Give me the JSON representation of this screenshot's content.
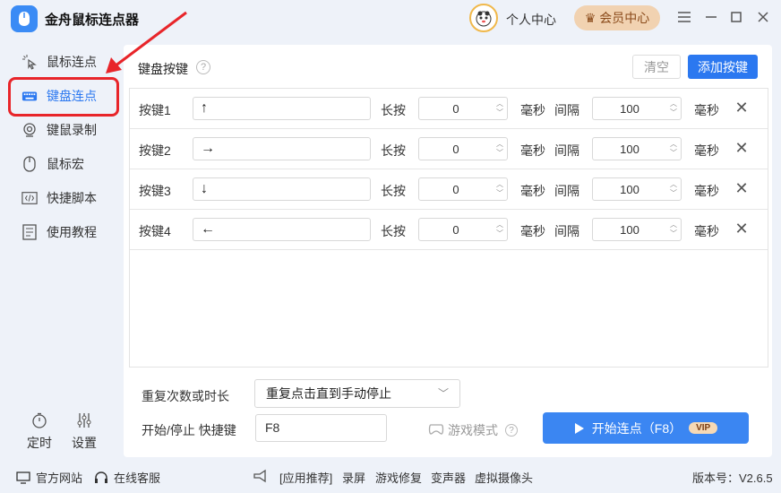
{
  "app": {
    "title": "金舟鼠标连点器"
  },
  "header": {
    "personal_center": "个人中心",
    "vip_center": "会员中心"
  },
  "sidebar": {
    "items": [
      {
        "label": "鼠标连点",
        "icon": "cursor-click-icon"
      },
      {
        "label": "键盘连点",
        "icon": "keyboard-icon"
      },
      {
        "label": "键鼠录制",
        "icon": "webcam-record-icon"
      },
      {
        "label": "鼠标宏",
        "icon": "mouse-icon"
      },
      {
        "label": "快捷脚本",
        "icon": "code-icon"
      },
      {
        "label": "使用教程",
        "icon": "document-icon"
      }
    ],
    "timer_label": "定时",
    "settings_label": "设置"
  },
  "main": {
    "title": "键盘按键",
    "help": "?",
    "clear_label": "清空",
    "add_label": "添加按键",
    "rows": [
      {
        "label": "按键1",
        "key": "↑",
        "press_label": "长按",
        "press_value": "0",
        "ms": "毫秒",
        "interval_label": "间隔",
        "interval_value": "100",
        "ms2": "毫秒"
      },
      {
        "label": "按键2",
        "key": "→",
        "press_label": "长按",
        "press_value": "0",
        "ms": "毫秒",
        "interval_label": "间隔",
        "interval_value": "100",
        "ms2": "毫秒"
      },
      {
        "label": "按键3",
        "key": "↓",
        "press_label": "长按",
        "press_value": "0",
        "ms": "毫秒",
        "interval_label": "间隔",
        "interval_value": "100",
        "ms2": "毫秒"
      },
      {
        "label": "按键4",
        "key": "←",
        "press_label": "长按",
        "press_value": "0",
        "ms": "毫秒",
        "interval_label": "间隔",
        "interval_value": "100",
        "ms2": "毫秒"
      }
    ],
    "repeat_label": "重复次数或时长",
    "repeat_value": "重复点击直到手动停止",
    "hotkey_label": "开始/停止 快捷键",
    "hotkey_value": "F8",
    "game_mode_label": "游戏模式",
    "start_label": "开始连点（F8）",
    "vip_tag": "VIP"
  },
  "footer": {
    "website": "官方网站",
    "support": "在线客服",
    "recommend": "[应用推荐]",
    "links": [
      "录屏",
      "游戏修复",
      "变声器",
      "虚拟摄像头"
    ],
    "version": "版本号：V2.6.5"
  },
  "colors": {
    "accent": "#2b78f0",
    "highlight": "#e8252a",
    "vip": "#f1d2b1"
  }
}
